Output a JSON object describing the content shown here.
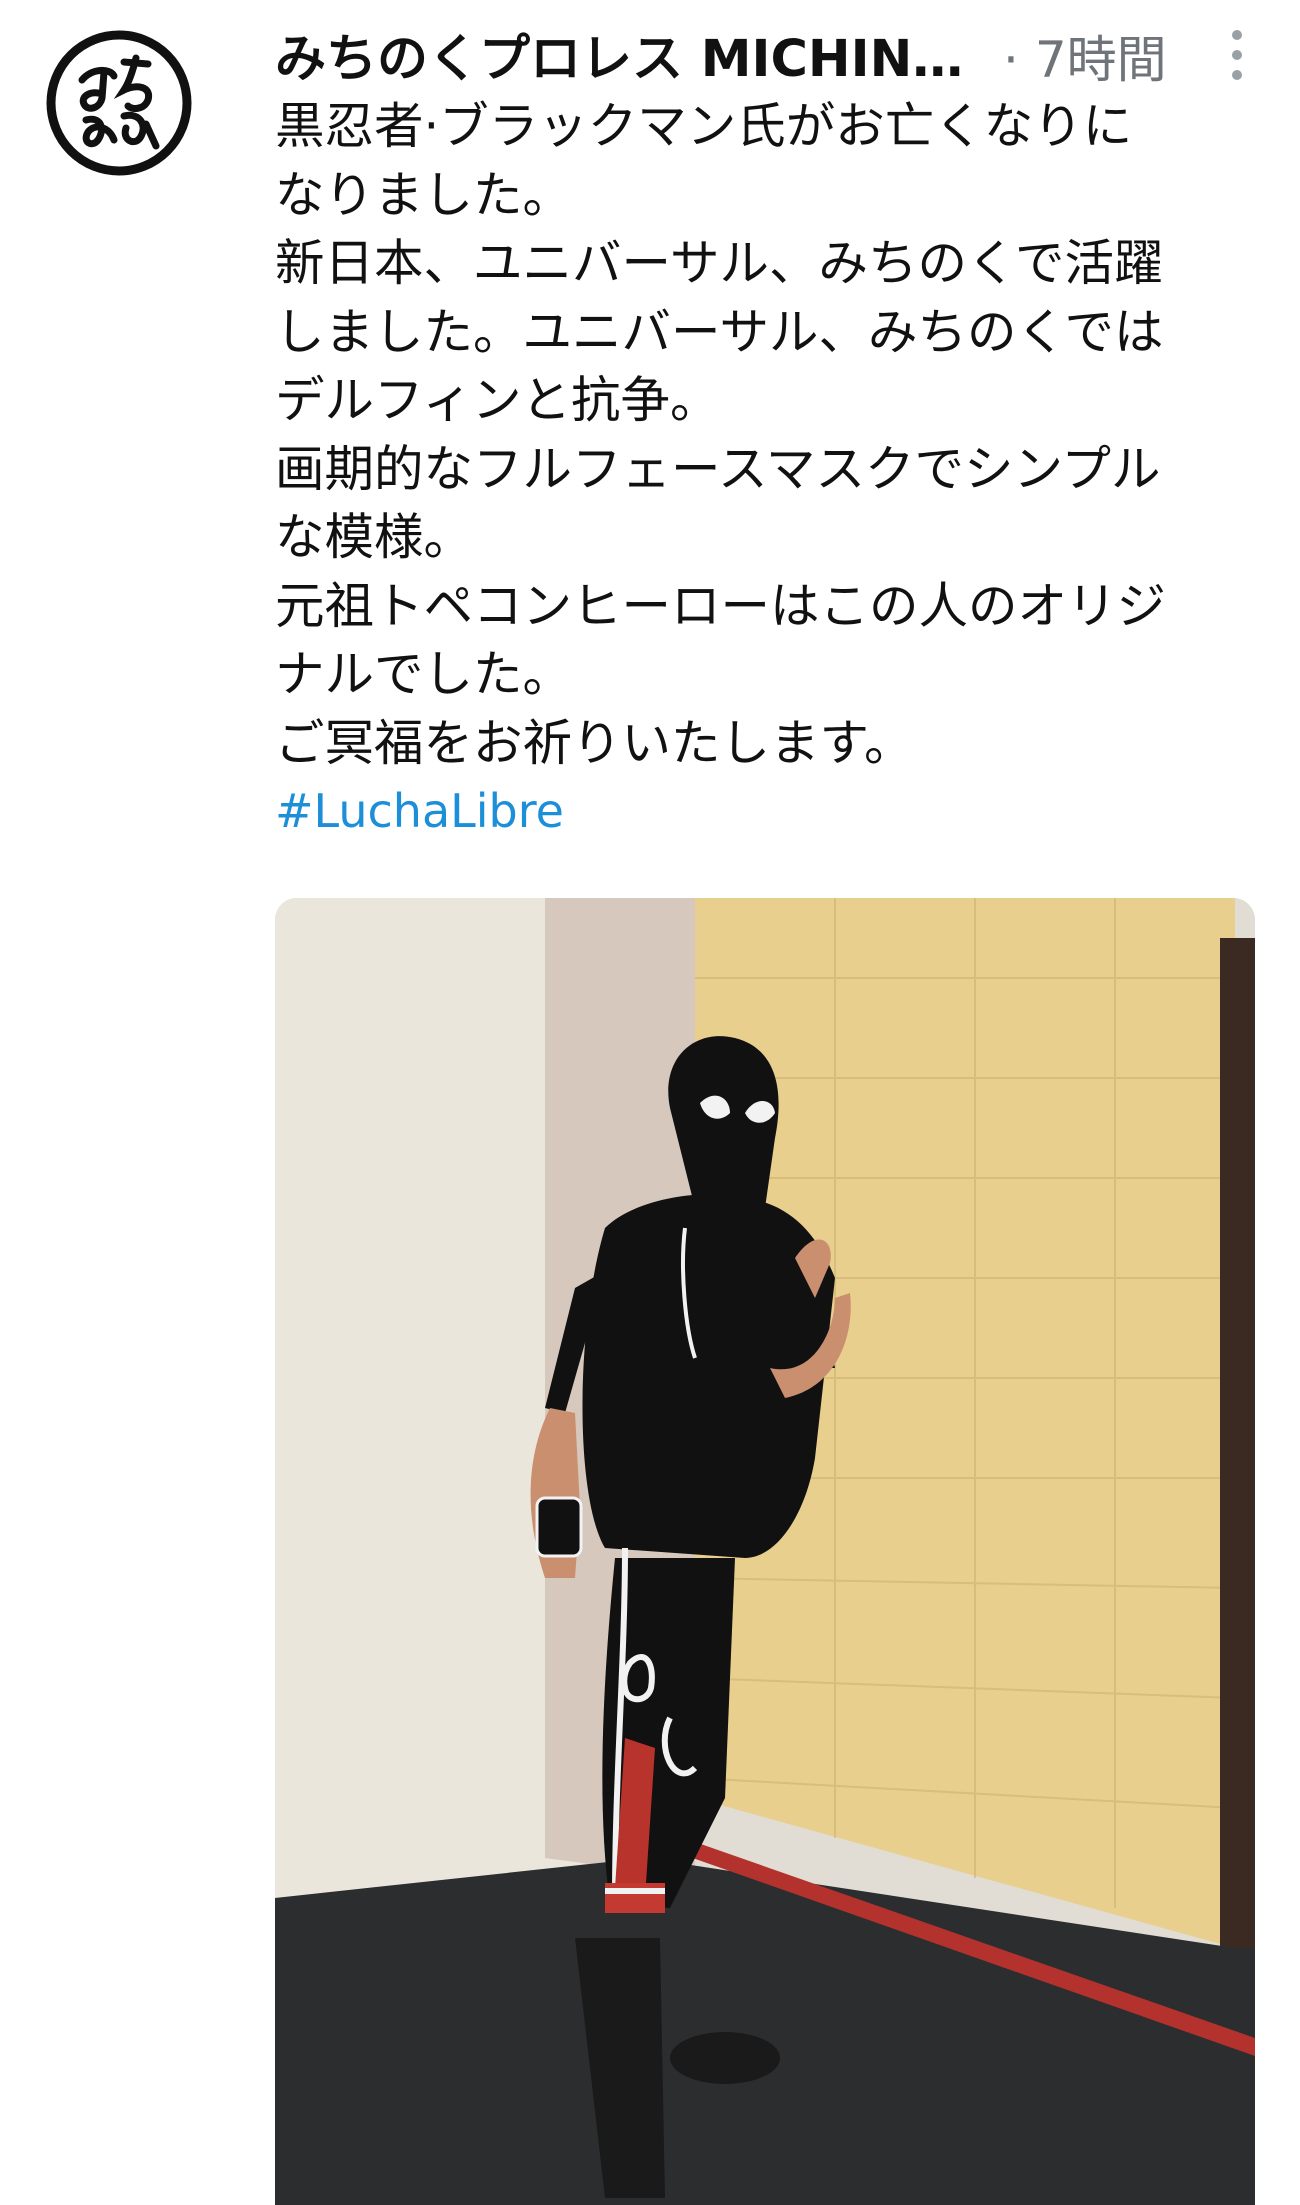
{
  "tweet": {
    "avatar_icon": "michinoku-pro-logo-icon",
    "display_name": "みちのくプロレス MICHIN…",
    "separator": "·",
    "timestamp": "7時間",
    "more_icon": "more-vertical-icon",
    "text_lines": [
      "黒忍者·ブラックマン氏がお亡くなりに",
      "なりました。",
      "新日本、ユニバーサル、みちのくで活躍",
      "しました。ユニバーサル、みちのくでは",
      "デルフィンと抗争。",
      "画期的なフルフェースマスクでシンプル",
      "な模様。",
      "元祖トペコンヒーローはこの人のオリジ",
      "ナルでした。",
      "ご冥福をお祈りいたします。"
    ],
    "hashtag": "#LuchaLibre"
  },
  "colors": {
    "text": "#111111",
    "muted": "#6e7479",
    "link": "#1d8fd9"
  }
}
